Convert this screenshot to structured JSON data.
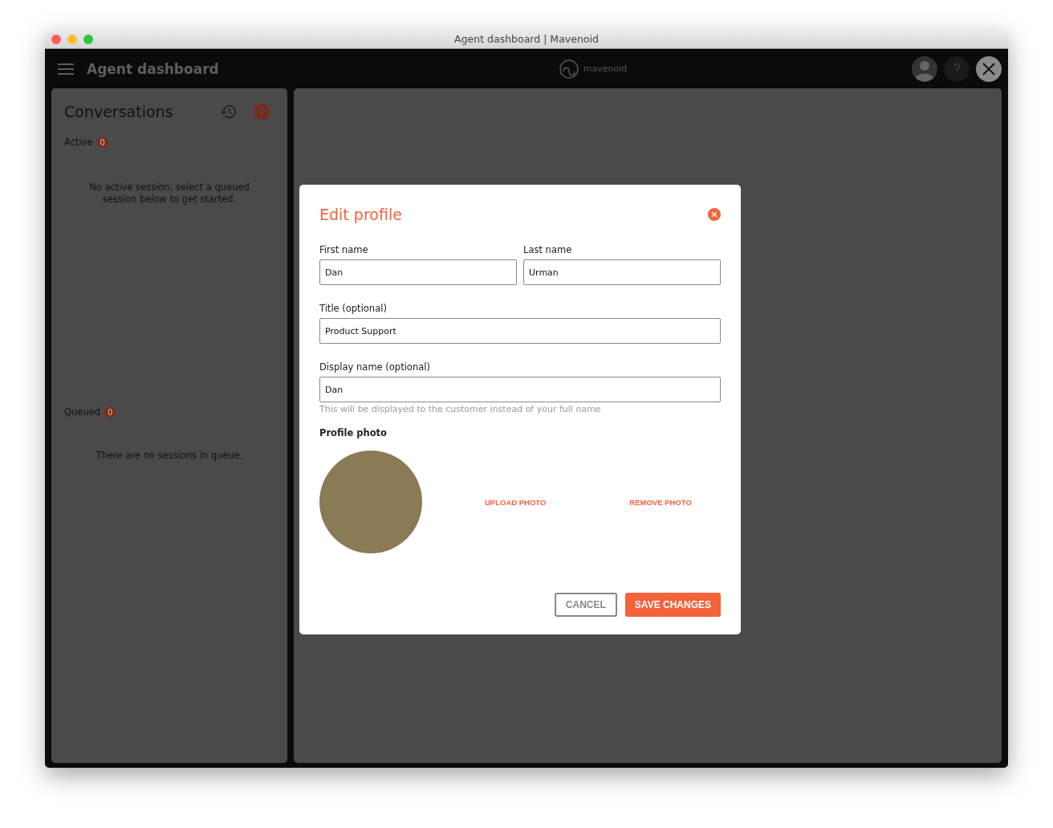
{
  "window": {
    "title": "Agent dashboard | Mavenoid"
  },
  "app_bar": {
    "title": "Agent dashboard",
    "logo_text": "mavenoid",
    "help": "?"
  },
  "conversations": {
    "title": "Conversations",
    "sections": [
      {
        "label": "Active",
        "count": "0",
        "empty": "No active session, select a queued session below to get started."
      },
      {
        "label": "Queued",
        "count": "0",
        "empty": "There are no sessions in queue."
      }
    ]
  },
  "modal": {
    "title": "Edit profile",
    "fields": [
      {
        "kind": "half",
        "label": "First name",
        "value": "Dan"
      },
      {
        "kind": "half",
        "label": "Last name",
        "value": "Urman"
      },
      {
        "kind": "full",
        "label": "Title (optional)",
        "value": "Product Support"
      },
      {
        "kind": "full",
        "label": "Display name (optional)",
        "value": "Dan",
        "hint": "This will be displayed to the customer instead of your full name"
      }
    ],
    "photo_label": "Profile photo",
    "upload": "UPLOAD PHOTO",
    "remove": "REMOVE PHOTO",
    "cancel": "CANCEL",
    "save": "SAVE CHANGES"
  }
}
